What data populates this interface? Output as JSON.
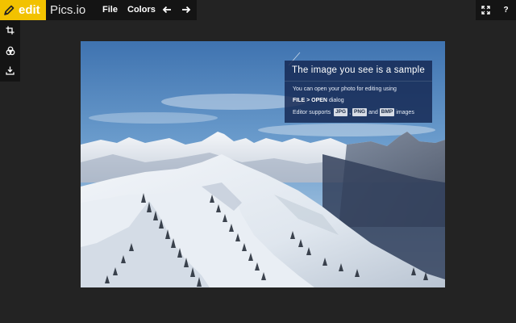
{
  "header": {
    "logo_word": "edit",
    "brand": "Pics.io",
    "menu": {
      "file": "File",
      "colors": "Colors"
    },
    "right_help": "?"
  },
  "notice": {
    "title": "The image you see is a sample",
    "line1": "You can open your photo for editing using",
    "line2_bold": "FILE > OPEN",
    "line2_rest": "dialog",
    "line3_prefix": "Editor supports",
    "format_jpg": "JPG",
    "comma": ",",
    "format_png": "PNG",
    "and_word": "and",
    "format_bmp": "BMP",
    "line3_suffix": "images"
  },
  "colors": {
    "accent": "#f2c200",
    "bar": "#141414",
    "canvas": "#232323"
  },
  "icons": {
    "logo": "pencil-icon",
    "undo": "arrow-left-icon",
    "redo": "arrow-right-icon",
    "fullscreen": "fullscreen-icon",
    "crop": "crop-icon",
    "color_adjust": "color-circles-icon",
    "download": "download-icon"
  }
}
